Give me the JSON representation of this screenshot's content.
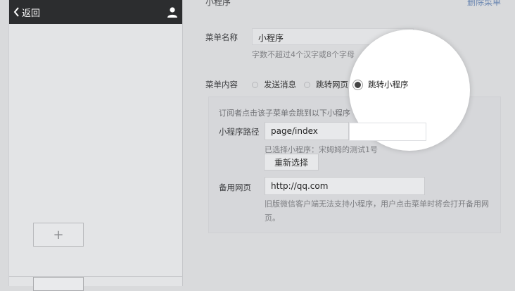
{
  "phone": {
    "back_label": "返回",
    "add_symbol": "+"
  },
  "editor": {
    "title": "小程序",
    "delete_link": "删除菜单",
    "menu_name_label": "菜单名称",
    "menu_name_value": "小程序",
    "menu_name_hint": "字数不超过4个汉字或8个字母",
    "menu_content_label": "菜单内容",
    "radio_options": [
      "发送消息",
      "跳转网页",
      "跳转小程序"
    ],
    "selected_option": "跳转小程序",
    "panel_hint": "订阅者点击该子菜单会跳到以下小程序",
    "mini_path_label": "小程序路径",
    "mini_path_value": "page/index",
    "selected_info": "已选择小程序：宋姆姆的测试1号",
    "reselect_label": "重新选择",
    "backup_label": "备用网页",
    "backup_value": "http://qq.com",
    "backup_hint_1": "旧版微信客户端无法支持小程序，用户点击菜单时将会打开备用网",
    "backup_hint_2": "页。"
  }
}
